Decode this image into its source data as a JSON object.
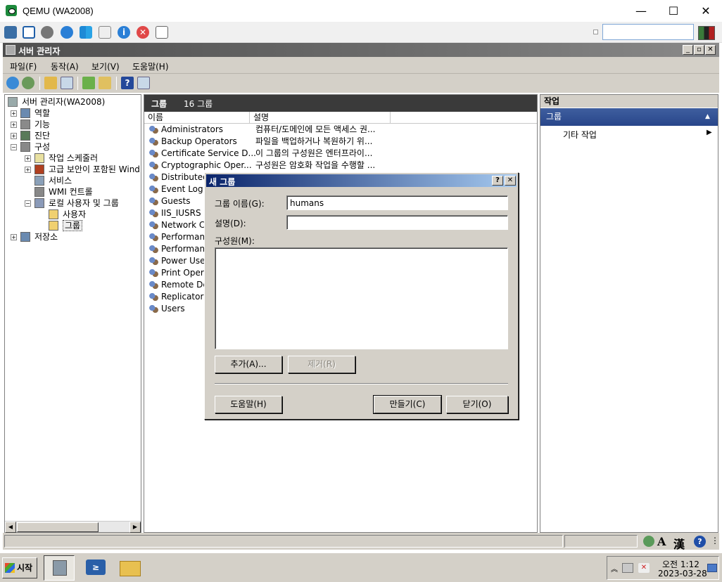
{
  "qemu": {
    "title": "QEMU (WA2008)",
    "minimize": "—",
    "maximize": "☐",
    "close": "✕",
    "search_value": ""
  },
  "window": {
    "title": "서버 관리자"
  },
  "menu": [
    "파일(F)",
    "동작(A)",
    "보기(V)",
    "도움말(H)"
  ],
  "tree": {
    "root": "서버 관리자(WA2008)",
    "items": [
      {
        "label": "역할",
        "exp": "+"
      },
      {
        "label": "기능",
        "exp": "+"
      },
      {
        "label": "진단",
        "exp": "+"
      },
      {
        "label": "구성",
        "exp": "−"
      },
      {
        "label": "작업 스케줄러",
        "exp": "+"
      },
      {
        "label": "고급 보안이 포함된 Wind",
        "exp": "+"
      },
      {
        "label": "서비스",
        "exp": ""
      },
      {
        "label": "WMI 컨트롤",
        "exp": ""
      },
      {
        "label": "로컬 사용자 및 그룹",
        "exp": "−"
      },
      {
        "label": "사용자",
        "exp": ""
      },
      {
        "label": "그룹",
        "exp": ""
      },
      {
        "label": "저장소",
        "exp": "+"
      }
    ]
  },
  "center": {
    "title": "그룹",
    "count": "16 그룹",
    "col_name": "이름",
    "col_desc": "설명",
    "rows": [
      {
        "name": "Administrators",
        "desc": "컴퓨터/도메인에 모든 액세스 권..."
      },
      {
        "name": "Backup Operators",
        "desc": "파일을 백업하거나 복원하기 위..."
      },
      {
        "name": "Certificate Service D...",
        "desc": "이 그룹의 구성원은 엔터프라이..."
      },
      {
        "name": "Cryptographic Oper...",
        "desc": "구성원은 암호화 작업을 수행할 ..."
      },
      {
        "name": "Distributed",
        "desc": ""
      },
      {
        "name": "Event Log I",
        "desc": ""
      },
      {
        "name": "Guests",
        "desc": ""
      },
      {
        "name": "IIS_IUSRS",
        "desc": ""
      },
      {
        "name": "Network Co",
        "desc": ""
      },
      {
        "name": "Performanc",
        "desc": ""
      },
      {
        "name": "Performanc",
        "desc": ""
      },
      {
        "name": "Power Use",
        "desc": ""
      },
      {
        "name": "Print Opera",
        "desc": ""
      },
      {
        "name": "Remote De",
        "desc": ""
      },
      {
        "name": "Replicator",
        "desc": ""
      },
      {
        "name": "Users",
        "desc": ""
      }
    ]
  },
  "actions": {
    "header": "작업",
    "section": "그룹",
    "item": "기타 작업"
  },
  "dialog": {
    "title": "새 그룹",
    "help_btn": "?",
    "close_btn": "✕",
    "name_label": "그룹 이름(G):",
    "name_value": "humans",
    "desc_label": "설명(D):",
    "desc_value": "",
    "members_label": "구성원(M):",
    "add_btn": "추가(A)...",
    "remove_btn": "제거(R)",
    "help_button": "도움말(H)",
    "create_btn": "만들기(C)",
    "close_button": "닫기(O)"
  },
  "taskbar": {
    "start": "시작",
    "time": "오전 1:12",
    "date": "2023-03-28"
  },
  "statusbar": {
    "ime_a": "A",
    "ime_han": "漢"
  }
}
